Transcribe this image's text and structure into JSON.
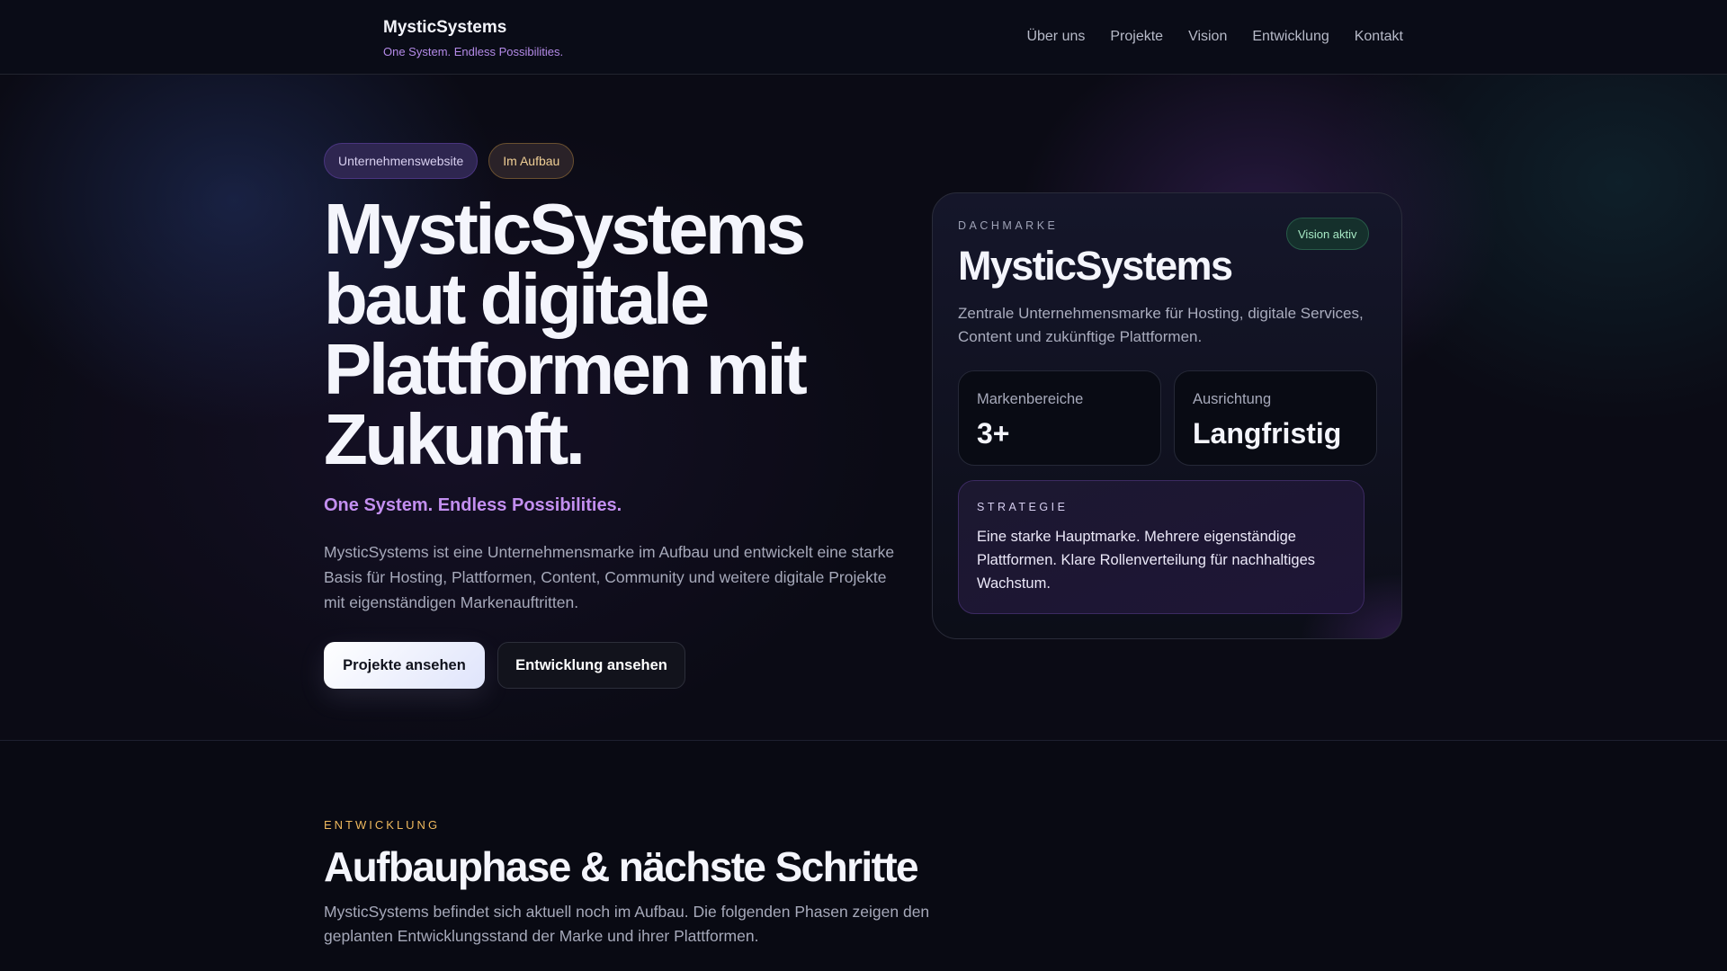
{
  "header": {
    "logo": "MysticSystems",
    "tagline": "One System. Endless Possibilities.",
    "nav": [
      "Über uns",
      "Projekte",
      "Vision",
      "Entwicklung",
      "Kontakt"
    ]
  },
  "hero": {
    "badges": [
      "Unternehmenswebsite",
      "Im Aufbau"
    ],
    "headline": "MysticSystems baut digitale Plattformen mit Zukunft.",
    "tagline": "One System. Endless Possibilities.",
    "intro": "MysticSystems ist eine Unternehmensmarke im Aufbau und entwickelt eine starke Basis für Hosting, Plattformen, Content, Community und weitere digitale Projekte mit eigenständigen Markenauftritten.",
    "primary_button": "Projekte ansehen",
    "secondary_button": "Entwicklung ansehen"
  },
  "card": {
    "eyebrow": "DACHMARKE",
    "status": "Vision aktiv",
    "title": "MysticSystems",
    "description": "Zentrale Unternehmensmarke für Hosting, digitale Services, Content und zukünftige Plattformen.",
    "stats": [
      {
        "label": "Markenbereiche",
        "value": "3+"
      },
      {
        "label": "Ausrichtung",
        "value": "Langfristig"
      }
    ],
    "strategy": {
      "eyebrow": "STRATEGIE",
      "text": "Eine starke Hauptmarke. Mehrere eigenständige Plattformen. Klare Rollenverteilung für nachhaltiges Wachstum."
    }
  },
  "development": {
    "eyebrow": "ENTWICKLUNG",
    "title": "Aufbauphase & nächste Schritte",
    "text": "MysticSystems befindet sich aktuell noch im Aufbau. Die folgenden Phasen zeigen den geplanten Entwicklungsstand der Marke und ihrer Plattformen."
  }
}
